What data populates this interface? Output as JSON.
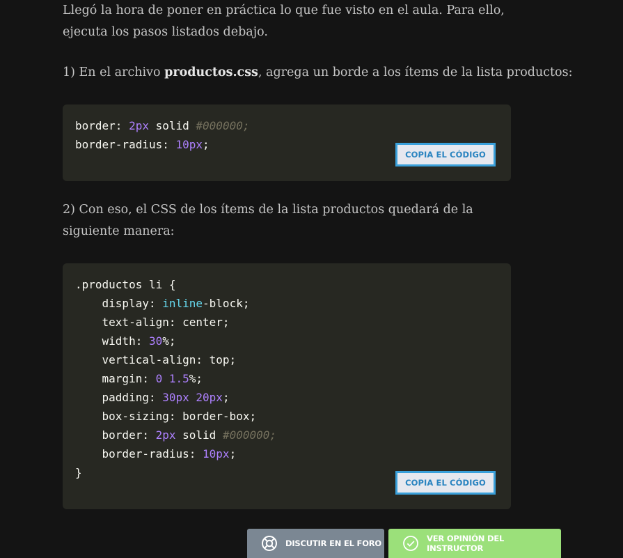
{
  "paragraphs": {
    "intro": "Llegó la hora de poner en práctica lo que fue visto en el aula. Para ello, ejecuta los pasos listados debajo.",
    "step1_prefix": "1) En el archivo ",
    "step1_file": "productos.css",
    "step1_suffix": ", agrega un borde a los ítems de la lista productos:",
    "step2": "2) Con eso, el CSS de los ítems de la lista productos quedará de la siguiente manera:"
  },
  "code_blocks": [
    {
      "lines": [
        [
          {
            "t": "border: ",
            "c": ""
          },
          {
            "t": "2px",
            "c": "num"
          },
          {
            "t": " solid ",
            "c": ""
          },
          {
            "t": "#000000;",
            "c": "cm"
          }
        ],
        [
          {
            "t": "border-radius: ",
            "c": ""
          },
          {
            "t": "10px",
            "c": "num"
          },
          {
            "t": ";",
            "c": ""
          }
        ]
      ]
    },
    {
      "lines": [
        [
          {
            "t": ".productos li {",
            "c": ""
          }
        ],
        [
          {
            "t": "    display: ",
            "c": ""
          },
          {
            "t": "inline",
            "c": "kw"
          },
          {
            "t": "-block;",
            "c": ""
          }
        ],
        [
          {
            "t": "    text-align: center;",
            "c": ""
          }
        ],
        [
          {
            "t": "    width: ",
            "c": ""
          },
          {
            "t": "30",
            "c": "num"
          },
          {
            "t": "%;",
            "c": ""
          }
        ],
        [
          {
            "t": "    vertical-align: top;",
            "c": ""
          }
        ],
        [
          {
            "t": "    margin: ",
            "c": ""
          },
          {
            "t": "0",
            "c": "num"
          },
          {
            "t": " ",
            "c": ""
          },
          {
            "t": "1.5",
            "c": "num"
          },
          {
            "t": "%;",
            "c": ""
          }
        ],
        [
          {
            "t": "    padding: ",
            "c": ""
          },
          {
            "t": "30px",
            "c": "num"
          },
          {
            "t": " ",
            "c": ""
          },
          {
            "t": "20px",
            "c": "num"
          },
          {
            "t": ";",
            "c": ""
          }
        ],
        [
          {
            "t": "    box-sizing: border-box;",
            "c": ""
          }
        ],
        [
          {
            "t": "    border: ",
            "c": ""
          },
          {
            "t": "2px",
            "c": "num"
          },
          {
            "t": " solid ",
            "c": ""
          },
          {
            "t": "#000000;",
            "c": "cm"
          }
        ],
        [
          {
            "t": "    border-radius: ",
            "c": ""
          },
          {
            "t": "10px",
            "c": "num"
          },
          {
            "t": ";",
            "c": ""
          }
        ],
        [
          {
            "t": "}",
            "c": ""
          }
        ]
      ]
    }
  ],
  "copy_button_label": "COPIA EL CÓDIGO",
  "actions": {
    "forum_label": "DISCUTIR EN EL FORO",
    "forum_icon": "lifebuoy-icon",
    "opinion_label": "VER OPINIÓN DEL INSTRUCTOR",
    "opinion_icon": "check-circle-icon"
  },
  "colors": {
    "background": "#141414",
    "code_background": "#272822",
    "copy_border": "#3aa0da",
    "forum_button": "#7b8793",
    "opinion_button": "#9be07a",
    "number_token": "#ae81ff",
    "keyword_token": "#66d9ef",
    "comment_token": "#75715e"
  }
}
